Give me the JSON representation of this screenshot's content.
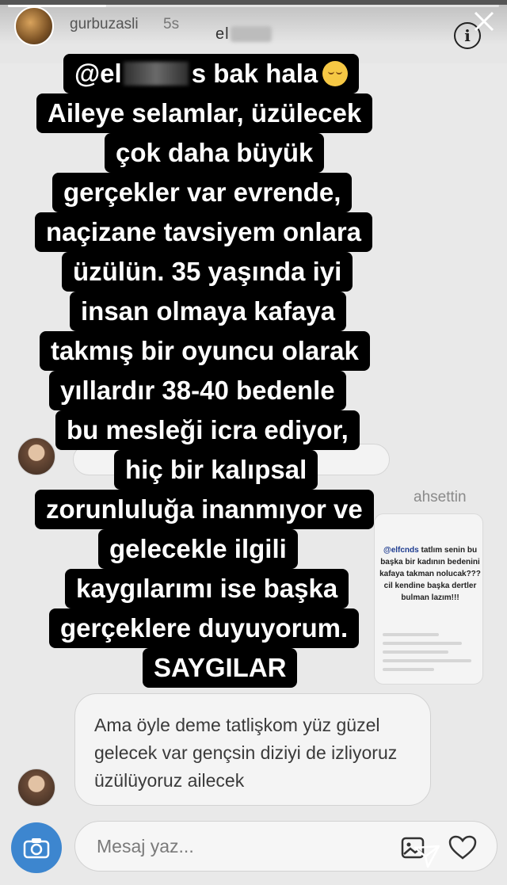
{
  "story": {
    "username": "gurbuzasli",
    "posted_ago": "5s",
    "progress": 0.2
  },
  "chat": {
    "title": "el s",
    "info_label": "i"
  },
  "caption": {
    "line1_a": "@el",
    "line1_b": "s bak hala",
    "lines": [
      "Aileye selamlar, üzülecek",
      "çok daha büyük",
      "gerçekler var evrende,",
      "naçizane tavsiyem onlara",
      "üzülün. 35 yaşında iyi",
      "insan olmaya kafaya",
      "takmış bir oyuncu olarak",
      "yıllardır 38-40 bedenle",
      "bu mesleği icra ediyor,",
      "hiç bir kalıpsal",
      "zorunluluğa inanmıyor ve",
      "gelecekle ilgili",
      "kaygılarımı ise başka",
      "gerçeklere duyuyorum.",
      "SAYGILAR"
    ]
  },
  "shared_post": {
    "sender_name": "ahsettin",
    "mention": "@elfcnds",
    "text": "tatlım senin bu başka bir kadının bedenini kafaya takman nolucak??? cil kendine başka dertler bulman lazım!!!"
  },
  "reply_message": {
    "text": "Ama öyle deme tatlişkom yüz güzel gelecek var gençsin diziyi de izliyoruz üzülüyoruz ailecek"
  },
  "composer": {
    "placeholder": "Mesaj yaz..."
  },
  "colors": {
    "camera_button": "#3d86cf",
    "caption_bg": "#000000",
    "caption_text": "#ffffff",
    "background": "#e9e9e9"
  },
  "icons": [
    "close-icon",
    "info-icon",
    "camera-icon",
    "gallery-icon",
    "heart-icon",
    "send-icon"
  ]
}
